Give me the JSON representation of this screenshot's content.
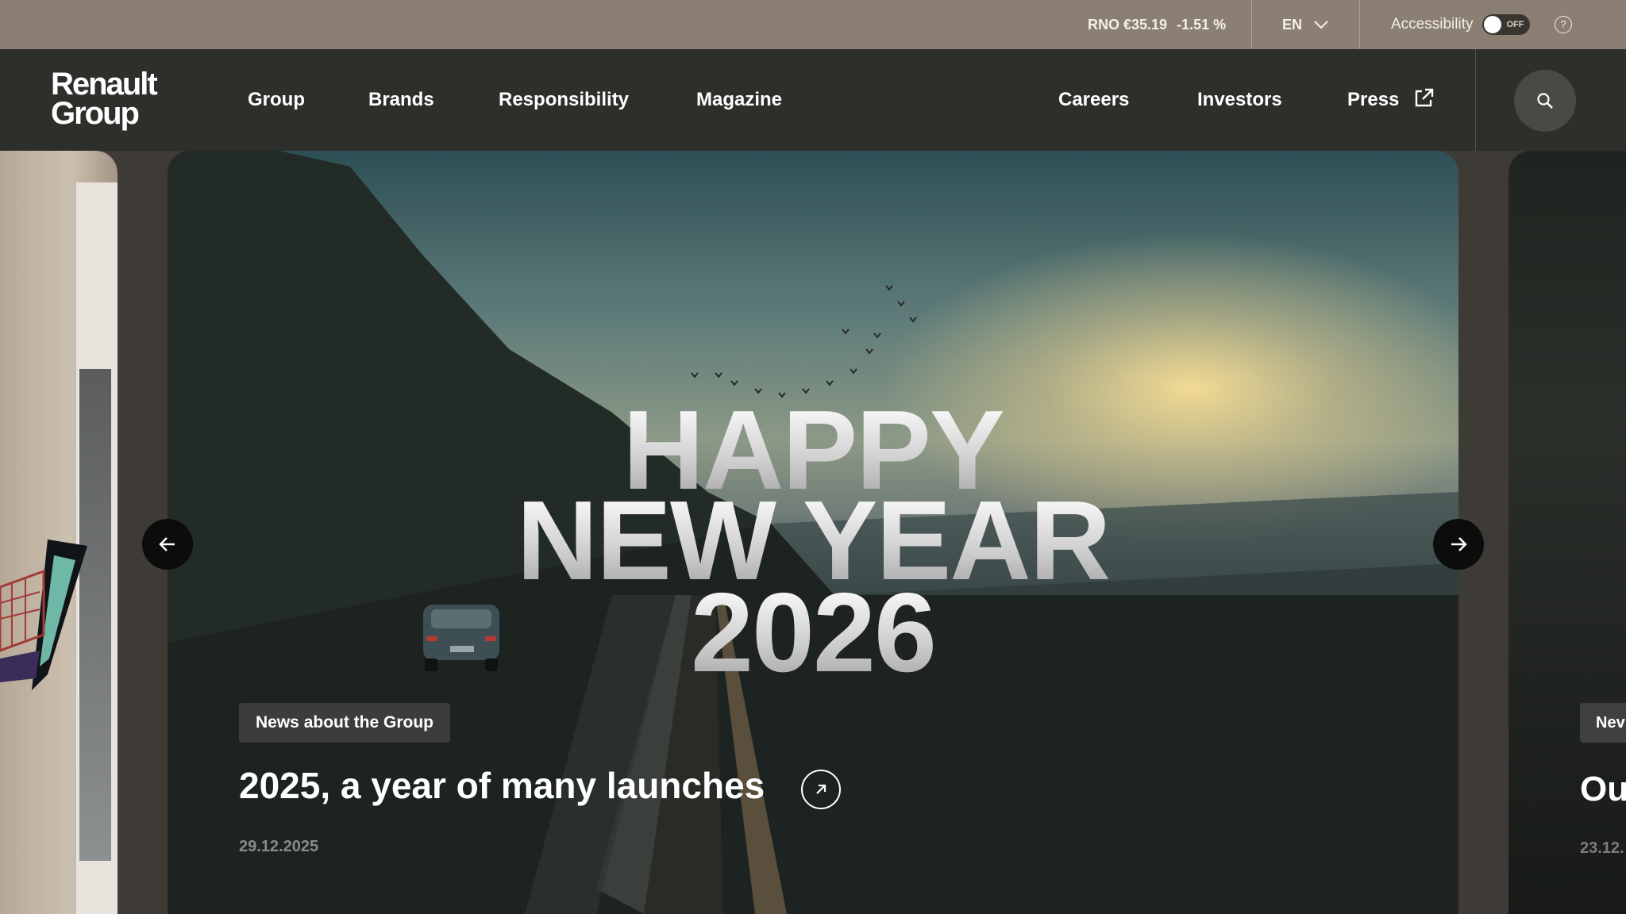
{
  "topbar": {
    "stock_symbol_price": "RNO €35.19",
    "stock_change": "-1.51 %",
    "language": "EN",
    "accessibility_label": "Accessibility",
    "accessibility_state": "OFF",
    "help_glyph": "?"
  },
  "nav": {
    "logo_line1": "Renault",
    "logo_line2": "Group",
    "left_items": [
      "Group",
      "Brands",
      "Responsibility",
      "Magazine"
    ],
    "right_items": [
      "Careers",
      "Investors",
      "Press"
    ],
    "search_icon": "search-icon"
  },
  "carousel": {
    "main": {
      "headline_lines": [
        "HAPPY",
        "NEW YEAR",
        "2026"
      ],
      "tag": "News about the Group",
      "title": "2025, a year of many launches",
      "date": "29.12.2025"
    },
    "next": {
      "tag": "Nev",
      "title": "Ou",
      "date": "23.12."
    }
  },
  "colors": {
    "topbar": "#8a7f72",
    "nav": "#2e2e2b",
    "arrow_button": "#0c0c0c"
  }
}
